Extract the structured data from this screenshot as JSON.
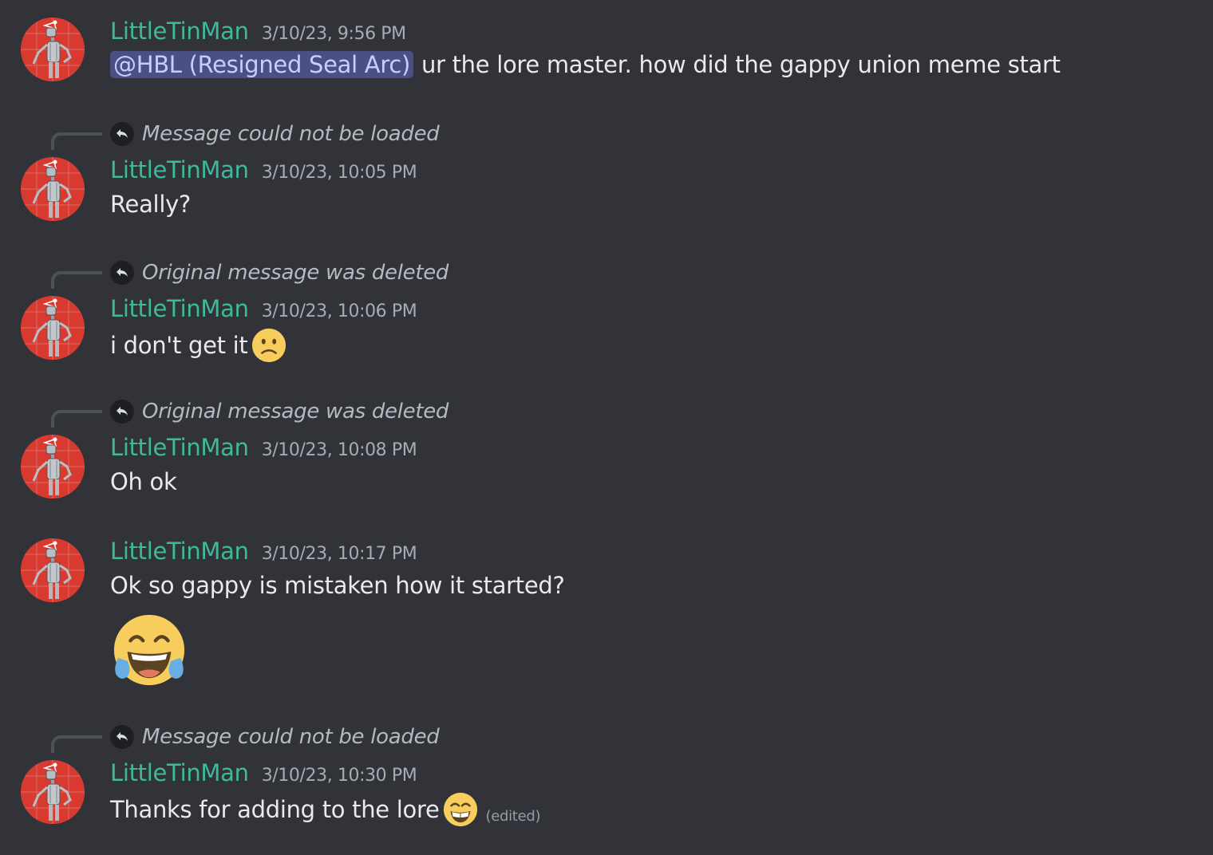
{
  "messages": [
    {
      "username": "LittleTinMan",
      "timestamp": "3/10/23, 9:56 PM",
      "mention": "@HBL (Resigned Seal Arc)",
      "text": "ur the lore master. how did the gappy union meme start"
    },
    {
      "reply_text": "Message could not be loaded",
      "username": "LittleTinMan",
      "timestamp": "3/10/23, 10:05 PM",
      "text": "Really?"
    },
    {
      "reply_text": "Original message was deleted",
      "username": "LittleTinMan",
      "timestamp": "3/10/23, 10:06 PM",
      "text": "i don't get it",
      "emoji": "slightly-frowning-face"
    },
    {
      "reply_text": "Original message was deleted",
      "username": "LittleTinMan",
      "timestamp": "3/10/23, 10:08 PM",
      "text": "Oh ok"
    },
    {
      "username": "LittleTinMan",
      "timestamp": "3/10/23, 10:17 PM",
      "text": "Ok so gappy is mistaken how it started?",
      "jumbo_emoji": "face-with-tears-of-joy"
    },
    {
      "reply_text": "Message could not be loaded",
      "username": "LittleTinMan",
      "timestamp": "3/10/23, 10:30 PM",
      "text": "Thanks for adding to the lore",
      "emoji": "grinning-face-with-smiling-eyes",
      "edited_label": "(edited)"
    }
  ],
  "colors": {
    "background": "#313338",
    "username": "#3fb998",
    "mention_bg": "#4a4f86",
    "avatar_bg": "#d93a30"
  }
}
